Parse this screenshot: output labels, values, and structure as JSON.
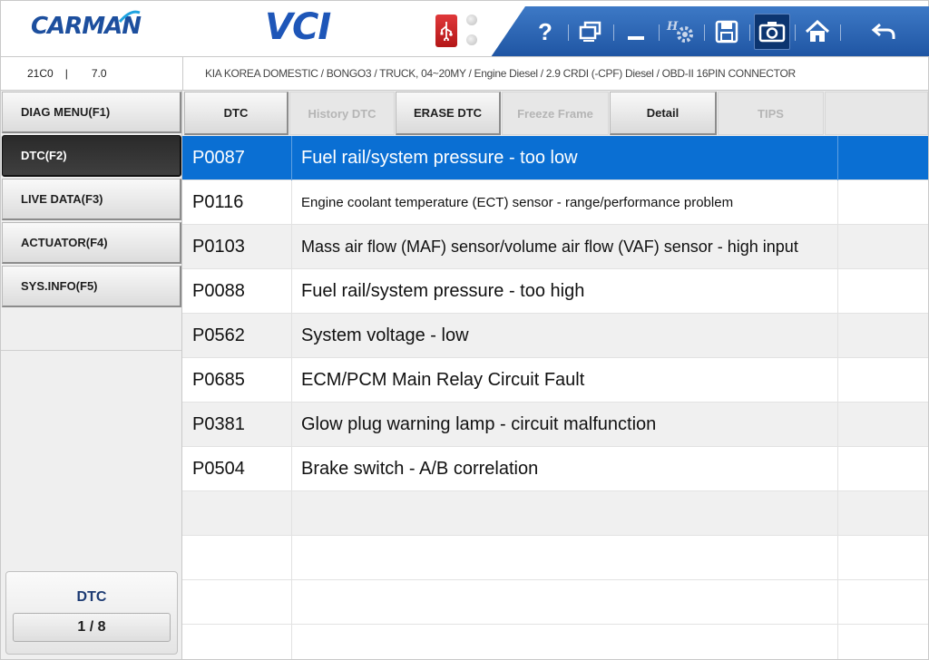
{
  "header": {
    "logo_text": "CARMAN",
    "product_name": "VCI",
    "toolbar": {
      "help_label": "?",
      "icons": [
        "help-icon",
        "window-icon",
        "minimize-icon",
        "settings-icon",
        "save-icon",
        "camera-icon",
        "home-icon",
        "back-icon"
      ]
    }
  },
  "infobar": {
    "version_code": "21C0",
    "separator": "|",
    "version_number": "7.0",
    "vehicle_path": "KIA KOREA DOMESTIC / BONGO3 / TRUCK, 04~20MY / Engine Diesel / 2.9 CRDI (-CPF) Diesel / OBD-II 16PIN CONNECTOR"
  },
  "sidebar": {
    "items": [
      {
        "label": "DIAG MENU(F1)"
      },
      {
        "label": "DTC(F2)"
      },
      {
        "label": "LIVE DATA(F3)"
      },
      {
        "label": "ACTUATOR(F4)"
      },
      {
        "label": "SYS.INFO(F5)"
      }
    ],
    "status_title": "DTC",
    "status_count": "1 / 8"
  },
  "tabs": [
    {
      "label": "DTC",
      "enabled": true
    },
    {
      "label": "History DTC",
      "enabled": false
    },
    {
      "label": "ERASE DTC",
      "enabled": true
    },
    {
      "label": "Freeze Frame",
      "enabled": false
    },
    {
      "label": "Detail",
      "enabled": true
    },
    {
      "label": "TIPS",
      "enabled": false
    }
  ],
  "dtc_table": {
    "rows": [
      {
        "code": "P0087",
        "description": "Fuel rail/system pressure - too low"
      },
      {
        "code": "P0116",
        "description": "Engine coolant temperature (ECT) sensor - range/performance problem"
      },
      {
        "code": "P0103",
        "description": "Mass air flow (MAF) sensor/volume air flow (VAF) sensor - high input"
      },
      {
        "code": "P0088",
        "description": "Fuel rail/system pressure - too high"
      },
      {
        "code": "P0562",
        "description": "System voltage - low"
      },
      {
        "code": "P0685",
        "description": "ECM/PCM Main Relay Circuit Fault"
      },
      {
        "code": "P0381",
        "description": "Glow plug warning lamp - circuit malfunction"
      },
      {
        "code": "P0504",
        "description": "Brake switch - A/B correlation"
      }
    ],
    "selected_row": "P0087"
  },
  "colors": {
    "brand_blue": "#1e56b8",
    "toolbar_blue": "#2c66b3",
    "selection_blue": "#0a6fd3",
    "usb_red": "#d3292b"
  }
}
